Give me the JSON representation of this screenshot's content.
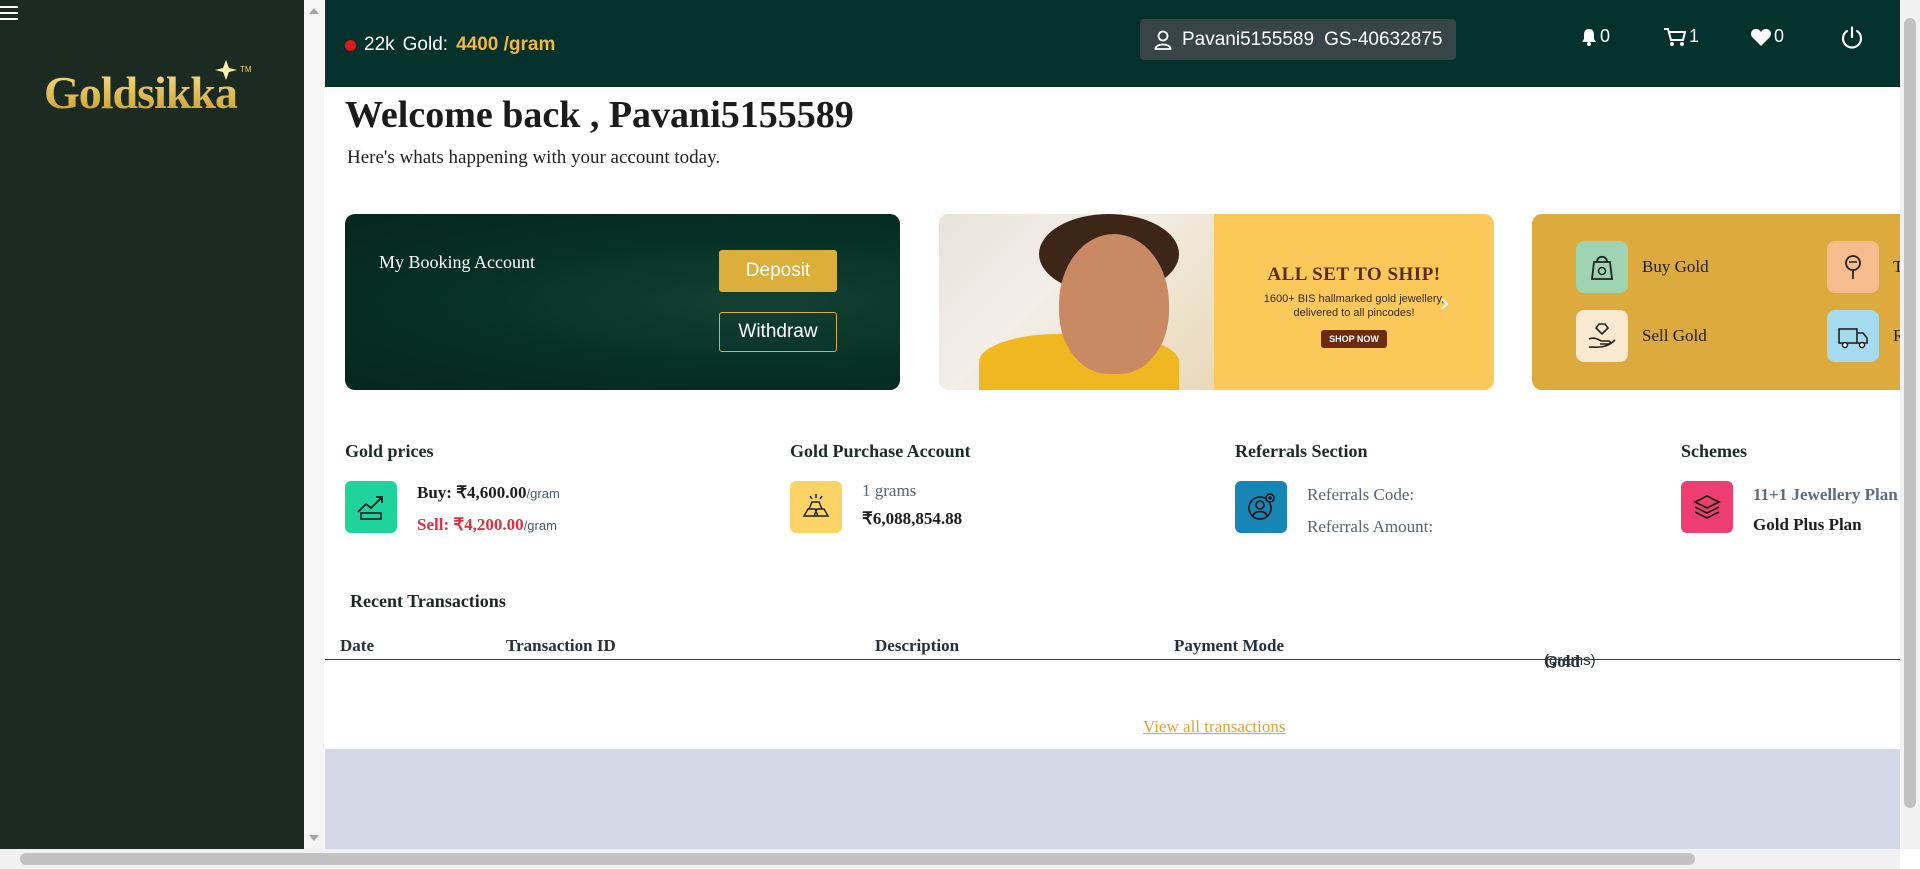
{
  "app": {
    "logo_text": "Goldsikka",
    "logo_tm": "TM"
  },
  "topbar": {
    "karat": "22k",
    "gold_label": "Gold:",
    "gold_rate": "4400 /gram",
    "username": "Pavani5155589",
    "user_id": "GS-40632875",
    "notifications_count": "0",
    "cart_count": "1",
    "wishlist_count": "0"
  },
  "welcome": {
    "title": "Welcome back , Pavani5155589",
    "subtitle": "Here's whats happening with your account today."
  },
  "booking": {
    "title": "My Booking Account",
    "deposit_label": "Deposit",
    "withdraw_label": "Withdraw"
  },
  "banner": {
    "headline": "ALL SET TO SHIP!",
    "line1": "1600+ BIS hallmarked gold jewellery,",
    "line2": "delivered to all pincodes!",
    "cta": "SHOP NOW"
  },
  "quick_actions": [
    {
      "label": "Buy Gold",
      "color": "#9fd4b2"
    },
    {
      "label": "T",
      "color": "#f6bc8b"
    },
    {
      "label": "Sell Gold",
      "color": "#fbe9cf"
    },
    {
      "label": "R",
      "color": "#a6dbef"
    }
  ],
  "gold_prices": {
    "title": "Gold prices",
    "buy_label": "Buy:",
    "buy_value": "₹4,600.00",
    "sell_label": "Sell:",
    "sell_value": "₹4,200.00",
    "unit": "/gram",
    "icon_color": "#1ed39c"
  },
  "gold_purchase": {
    "title": "Gold Purchase Account",
    "grams": "1 grams",
    "amount": "₹6,088,854.88",
    "icon_color": "#fcd466"
  },
  "referrals": {
    "title": "Referrals Section",
    "code_label": "Referrals Code:",
    "amount_label": "Referrals Amount:",
    "icon_color": "#1586b5"
  },
  "schemes": {
    "title": "Schemes",
    "plan1": "11+1 Jewellery Plan",
    "plan2": "Gold Plus Plan",
    "icon_color": "#ee3d72"
  },
  "transactions": {
    "title": "Recent Transactions",
    "columns": [
      "Date",
      "Transaction ID",
      "Description",
      "Payment Mode",
      "Gold"
    ],
    "gold_unit": "(grams)",
    "view_all": "View all transactions"
  }
}
